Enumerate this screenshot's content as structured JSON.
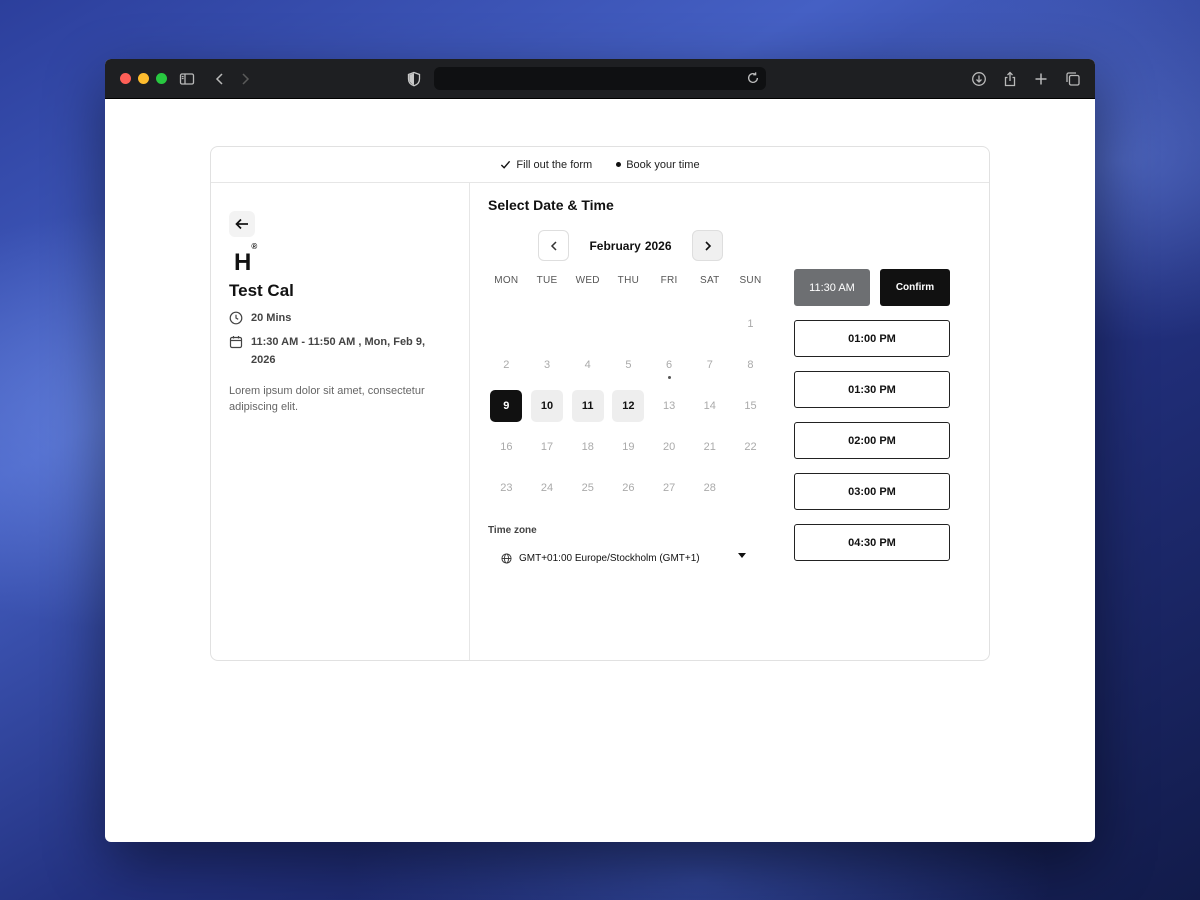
{
  "steps": [
    {
      "icon": "check-icon",
      "label": "Fill out the form"
    },
    {
      "icon": "bullet-icon",
      "label": "Book your time"
    }
  ],
  "event": {
    "logo_text": "H",
    "logo_mark": "®",
    "title": "Test Cal",
    "duration": "20 Mins",
    "when": "11:30 AM - 11:50 AM , Mon, Feb 9, 2026",
    "description": "Lorem ipsum dolor sit amet, consectetur adipiscing elit."
  },
  "calendar": {
    "heading": "Select Date & Time",
    "month": "February",
    "year": "2026",
    "weekdays": [
      "MON",
      "TUE",
      "WED",
      "THU",
      "FRI",
      "SAT",
      "SUN"
    ],
    "weeks": [
      [
        "",
        "",
        "",
        "",
        "",
        "",
        "1"
      ],
      [
        "2",
        "3",
        "4",
        "5",
        "6",
        "7",
        "8"
      ],
      [
        "9",
        "10",
        "11",
        "12",
        "13",
        "14",
        "15"
      ],
      [
        "16",
        "17",
        "18",
        "19",
        "20",
        "21",
        "22"
      ],
      [
        "23",
        "24",
        "25",
        "26",
        "27",
        "28",
        ""
      ]
    ],
    "selected_day": "9",
    "available_days": [
      "10",
      "11",
      "12"
    ],
    "today": "6"
  },
  "timezone": {
    "label": "Time zone",
    "value": "GMT+01:00 Europe/Stockholm (GMT+1)"
  },
  "slots": {
    "selected": "11:30 AM",
    "confirm_label": "Confirm",
    "times": [
      "01:00 PM",
      "01:30 PM",
      "02:00 PM",
      "03:00 PM",
      "04:30 PM"
    ]
  }
}
